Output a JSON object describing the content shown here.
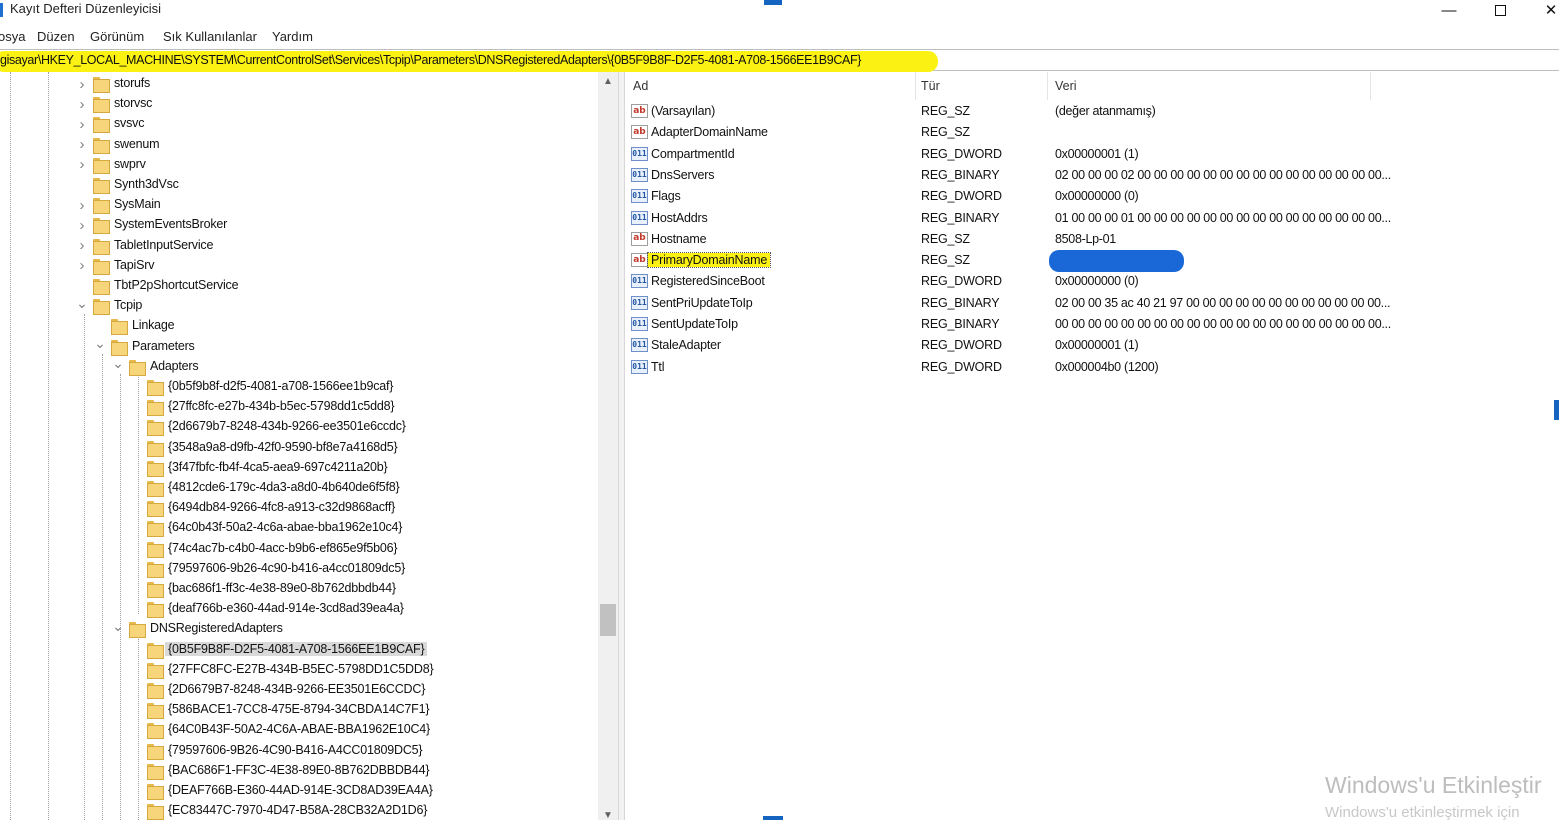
{
  "window": {
    "title": "Kayıt Defteri Düzenleyicisi",
    "minimize_glyph": "—",
    "close_glyph": "✕",
    "accent_color": "#1565c0"
  },
  "menu": [
    "osya",
    "Düzen",
    "Görünüm",
    "Sık Kullanılanlar",
    "Yardım"
  ],
  "address": {
    "path": "gisayar\\HKEY_LOCAL_MACHINE\\SYSTEM\\CurrentControlSet\\Services\\Tcpip\\Parameters\\DNSRegisteredAdapters\\{0B5F9B8F-D2F5-4081-A708-1566EE1B9CAF}",
    "highlight_color": "#fbf213"
  },
  "tree": {
    "chevron_collapsed": "›",
    "chevron_expanded": "⌄",
    "scroll_up": "▲",
    "scroll_down": "▼",
    "items": [
      {
        "label": "storufs",
        "level": 0,
        "state": "collapsed"
      },
      {
        "label": "storvsc",
        "level": 0,
        "state": "collapsed"
      },
      {
        "label": "svsvc",
        "level": 0,
        "state": "collapsed"
      },
      {
        "label": "swenum",
        "level": 0,
        "state": "collapsed"
      },
      {
        "label": "swprv",
        "level": 0,
        "state": "collapsed"
      },
      {
        "label": "Synth3dVsc",
        "level": 0,
        "state": "leaf"
      },
      {
        "label": "SysMain",
        "level": 0,
        "state": "collapsed"
      },
      {
        "label": "SystemEventsBroker",
        "level": 0,
        "state": "collapsed"
      },
      {
        "label": "TabletInputService",
        "level": 0,
        "state": "collapsed"
      },
      {
        "label": "TapiSrv",
        "level": 0,
        "state": "collapsed"
      },
      {
        "label": "TbtP2pShortcutService",
        "level": 0,
        "state": "leaf"
      },
      {
        "label": "Tcpip",
        "level": 0,
        "state": "expanded"
      },
      {
        "label": "Linkage",
        "level": 1,
        "state": "leaf"
      },
      {
        "label": "Parameters",
        "level": 1,
        "state": "expanded"
      },
      {
        "label": "Adapters",
        "level": 2,
        "state": "expanded"
      },
      {
        "label": "{0b5f9b8f-d2f5-4081-a708-1566ee1b9caf}",
        "level": 3,
        "state": "leaf"
      },
      {
        "label": "{27ffc8fc-e27b-434b-b5ec-5798dd1c5dd8}",
        "level": 3,
        "state": "leaf"
      },
      {
        "label": "{2d6679b7-8248-434b-9266-ee3501e6ccdc}",
        "level": 3,
        "state": "leaf"
      },
      {
        "label": "{3548a9a8-d9fb-42f0-9590-bf8e7a4168d5}",
        "level": 3,
        "state": "leaf"
      },
      {
        "label": "{3f47fbfc-fb4f-4ca5-aea9-697c4211a20b}",
        "level": 3,
        "state": "leaf"
      },
      {
        "label": "{4812cde6-179c-4da3-a8d0-4b640de6f5f8}",
        "level": 3,
        "state": "leaf"
      },
      {
        "label": "{6494db84-9266-4fc8-a913-c32d9868acff}",
        "level": 3,
        "state": "leaf"
      },
      {
        "label": "{64c0b43f-50a2-4c6a-abae-bba1962e10c4}",
        "level": 3,
        "state": "leaf"
      },
      {
        "label": "{74c4ac7b-c4b0-4acc-b9b6-ef865e9f5b06}",
        "level": 3,
        "state": "leaf"
      },
      {
        "label": "{79597606-9b26-4c90-b416-a4cc01809dc5}",
        "level": 3,
        "state": "leaf"
      },
      {
        "label": "{bac686f1-ff3c-4e38-89e0-8b762dbbdb44}",
        "level": 3,
        "state": "leaf"
      },
      {
        "label": "{deaf766b-e360-44ad-914e-3cd8ad39ea4a}",
        "level": 3,
        "state": "leaf"
      },
      {
        "label": "DNSRegisteredAdapters",
        "level": 2,
        "state": "expanded"
      },
      {
        "label": "{0B5F9B8F-D2F5-4081-A708-1566EE1B9CAF}",
        "level": 3,
        "state": "leaf",
        "selected": true
      },
      {
        "label": "{27FFC8FC-E27B-434B-B5EC-5798DD1C5DD8}",
        "level": 3,
        "state": "leaf"
      },
      {
        "label": "{2D6679B7-8248-434B-9266-EE3501E6CCDC}",
        "level": 3,
        "state": "leaf"
      },
      {
        "label": "{586BACE1-7CC8-475E-8794-34CBDA14C7F1}",
        "level": 3,
        "state": "leaf"
      },
      {
        "label": "{64C0B43F-50A2-4C6A-ABAE-BBA1962E10C4}",
        "level": 3,
        "state": "leaf"
      },
      {
        "label": "{79597606-9B26-4C90-B416-A4CC01809DC5}",
        "level": 3,
        "state": "leaf"
      },
      {
        "label": "{BAC686F1-FF3C-4E38-89E0-8B762DBBDB44}",
        "level": 3,
        "state": "leaf"
      },
      {
        "label": "{DEAF766B-E360-44AD-914E-3CD8AD39EA4A}",
        "level": 3,
        "state": "leaf"
      },
      {
        "label": "{EC83447C-7970-4D47-B58A-28CB32A2D1D6}",
        "level": 3,
        "state": "leaf"
      }
    ]
  },
  "values": {
    "columns": {
      "name": "Ad",
      "type": "Tür",
      "data": "Veri"
    },
    "icon_glyphs": {
      "string": "ab",
      "binary": "011"
    },
    "rows": [
      {
        "icon": "string",
        "name": "(Varsayılan)",
        "type": "REG_SZ",
        "data": "(değer atanmamış)"
      },
      {
        "icon": "string",
        "name": "AdapterDomainName",
        "type": "REG_SZ",
        "data": ""
      },
      {
        "icon": "binary",
        "name": "CompartmentId",
        "type": "REG_DWORD",
        "data": "0x00000001 (1)"
      },
      {
        "icon": "binary",
        "name": "DnsServers",
        "type": "REG_BINARY",
        "data": "02 00 00 00 02 00 00 00 00 00 00 00 00 00 00 00 00 00 00 00..."
      },
      {
        "icon": "binary",
        "name": "Flags",
        "type": "REG_DWORD",
        "data": "0x00000000 (0)"
      },
      {
        "icon": "binary",
        "name": "HostAddrs",
        "type": "REG_BINARY",
        "data": "01 00 00 00 01 00 00 00 00 00 00 00 00 00 00 00 00 00 00 00..."
      },
      {
        "icon": "string",
        "name": "Hostname",
        "type": "REG_SZ",
        "data": "8508-Lp-01"
      },
      {
        "icon": "string",
        "name": "PrimaryDomainName",
        "type": "REG_SZ",
        "data": "",
        "highlighted": true,
        "redacted": true
      },
      {
        "icon": "binary",
        "name": "RegisteredSinceBoot",
        "type": "REG_DWORD",
        "data": "0x00000000 (0)"
      },
      {
        "icon": "binary",
        "name": "SentPriUpdateToIp",
        "type": "REG_BINARY",
        "data": "02 00 00 35 ac 40 21 97 00 00 00 00 00 00 00 00 00 00 00 00..."
      },
      {
        "icon": "binary",
        "name": "SentUpdateToIp",
        "type": "REG_BINARY",
        "data": "00 00 00 00 00 00 00 00 00 00 00 00 00 00 00 00 00 00 00 00..."
      },
      {
        "icon": "binary",
        "name": "StaleAdapter",
        "type": "REG_DWORD",
        "data": "0x00000001 (1)"
      },
      {
        "icon": "binary",
        "name": "Ttl",
        "type": "REG_DWORD",
        "data": "0x000004b0 (1200)"
      }
    ]
  },
  "watermark": {
    "title": "Windows'u Etkinleştir",
    "subtitle": "Windows'u etkinleştirmek için"
  }
}
